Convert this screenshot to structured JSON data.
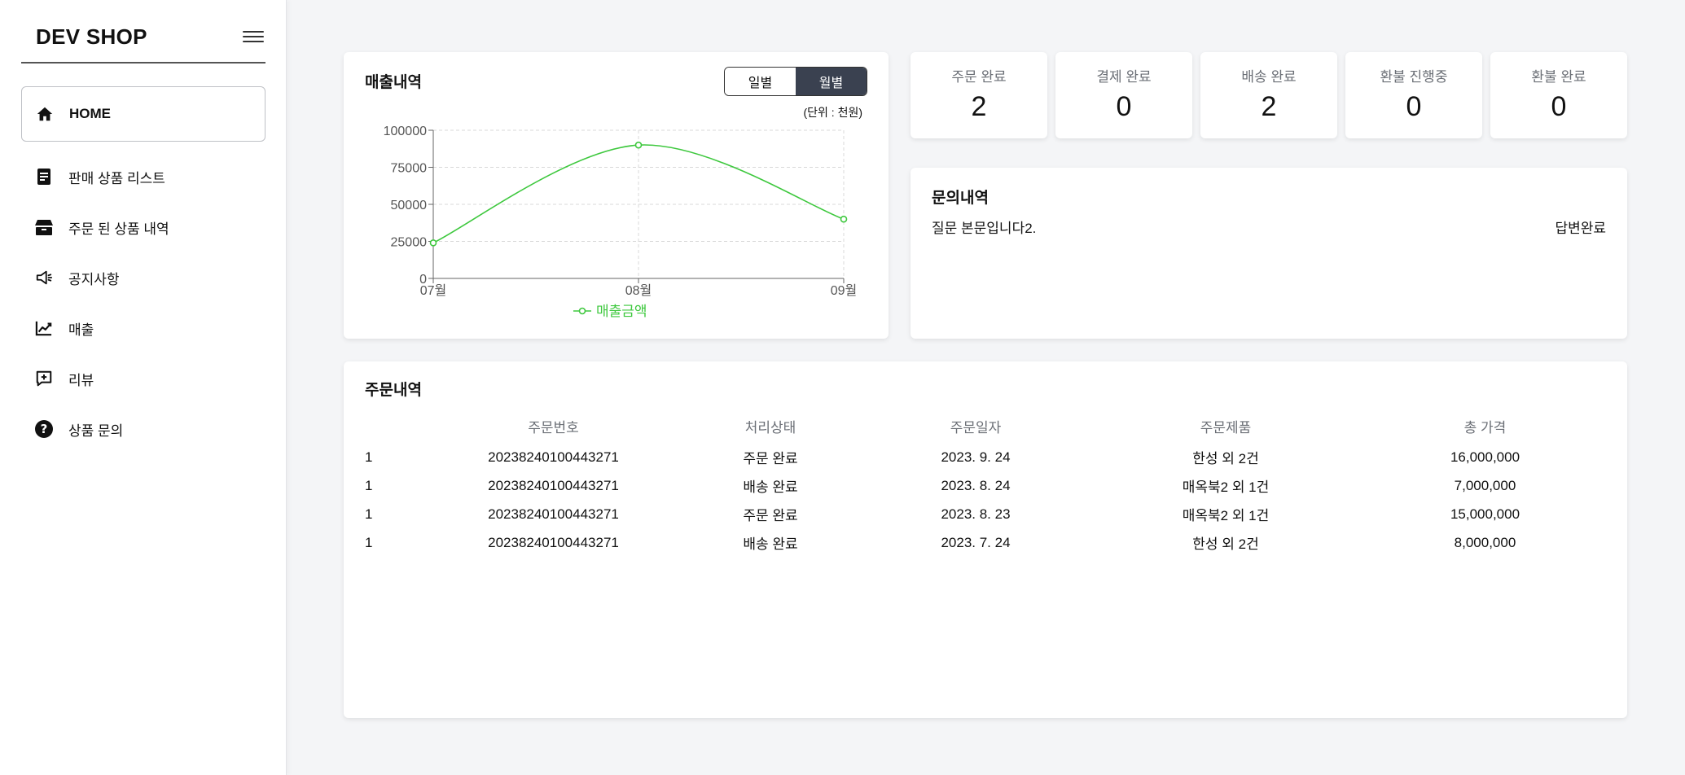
{
  "sidebar": {
    "brand": "DEV SHOP",
    "items": [
      {
        "label": "HOME",
        "icon": "home-icon"
      },
      {
        "label": "판매 상품 리스트",
        "icon": "document-icon"
      },
      {
        "label": "주문 된 상품 내역",
        "icon": "box-icon"
      },
      {
        "label": "공지사항",
        "icon": "megaphone-icon"
      },
      {
        "label": "매출",
        "icon": "trend-chart-icon"
      },
      {
        "label": "리뷰",
        "icon": "review-add-icon"
      },
      {
        "label": "상품 문의",
        "icon": "question-icon"
      }
    ]
  },
  "sales": {
    "title": "매출내역",
    "toggle": {
      "daily": "일별",
      "monthly": "월별",
      "selected": "monthly"
    },
    "unit": "(단위 : 천원)"
  },
  "chart_data": {
    "type": "line",
    "categories": [
      "07월",
      "08월",
      "09월"
    ],
    "series": [
      {
        "name": "매출금액",
        "values": [
          24000,
          90000,
          40000
        ],
        "color": "#3ec83e"
      }
    ],
    "ylim": [
      0,
      100000
    ],
    "yticks": [
      0,
      25000,
      50000,
      75000,
      100000
    ],
    "grid": true,
    "legend": "bottom-center",
    "title": "",
    "xlabel": "",
    "ylabel": ""
  },
  "stats": [
    {
      "label": "주문 완료",
      "value": "2"
    },
    {
      "label": "결제 완료",
      "value": "0"
    },
    {
      "label": "배송 완료",
      "value": "2"
    },
    {
      "label": "환불 진행중",
      "value": "0"
    },
    {
      "label": "환불 완료",
      "value": "0"
    }
  ],
  "inquiries": {
    "title": "문의내역",
    "items": [
      {
        "question": "질문 본문입니다2.",
        "status": "답변완료"
      }
    ]
  },
  "orders": {
    "title": "주문내역",
    "columns": [
      "",
      "주문번호",
      "처리상태",
      "주문일자",
      "주문제품",
      "총 가격"
    ],
    "rows": [
      [
        "1",
        "20238240100443271",
        "주문 완료",
        "2023. 9. 24",
        "한성 외 2건",
        "16,000,000"
      ],
      [
        "1",
        "20238240100443271",
        "배송 완료",
        "2023. 8. 24",
        "매옥북2 외 1건",
        "7,000,000"
      ],
      [
        "1",
        "20238240100443271",
        "주문 완료",
        "2023. 8. 23",
        "매옥북2 외 1건",
        "15,000,000"
      ],
      [
        "1",
        "20238240100443271",
        "배송 완료",
        "2023. 7. 24",
        "한성 외 2건",
        "8,000,000"
      ]
    ]
  }
}
